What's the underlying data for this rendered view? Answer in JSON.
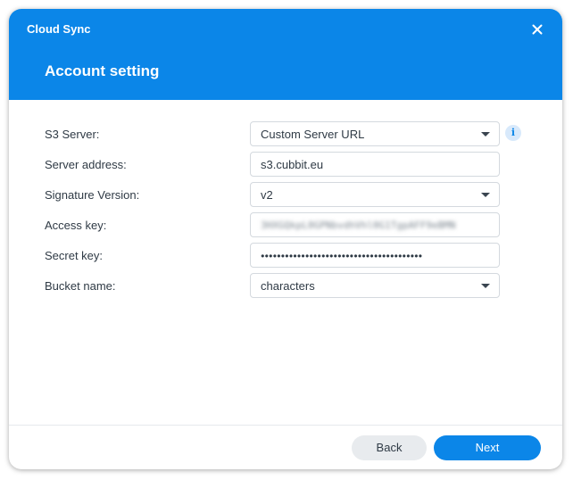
{
  "window": {
    "app_title": "Cloud Sync",
    "page_title": "Account setting",
    "close_icon": "close-icon"
  },
  "form": {
    "s3_server": {
      "label": "S3 Server:",
      "value": "Custom Server URL",
      "info_icon": "info-icon",
      "info_glyph": "i"
    },
    "server_address": {
      "label": "Server address:",
      "value": "s3.cubbit.eu"
    },
    "signature_version": {
      "label": "Signature Version:",
      "value": "v2"
    },
    "access_key": {
      "label": "Access key:",
      "value": "3HXGQkpL0GPNbvdhVhl0G1TgpAFF9eBMN"
    },
    "secret_key": {
      "label": "Secret key:",
      "value": "●●●●●●●●●●●●●●●●●●●●●●●●●●●●●●●●●●●●●●●●"
    },
    "bucket_name": {
      "label": "Bucket name:",
      "value": "characters"
    }
  },
  "footer": {
    "back_label": "Back",
    "next_label": "Next"
  },
  "colors": {
    "accent": "#0b86e8",
    "header_text": "#ffffff",
    "body_text": "#2f3a45",
    "secondary_button": "#e8ebee"
  }
}
